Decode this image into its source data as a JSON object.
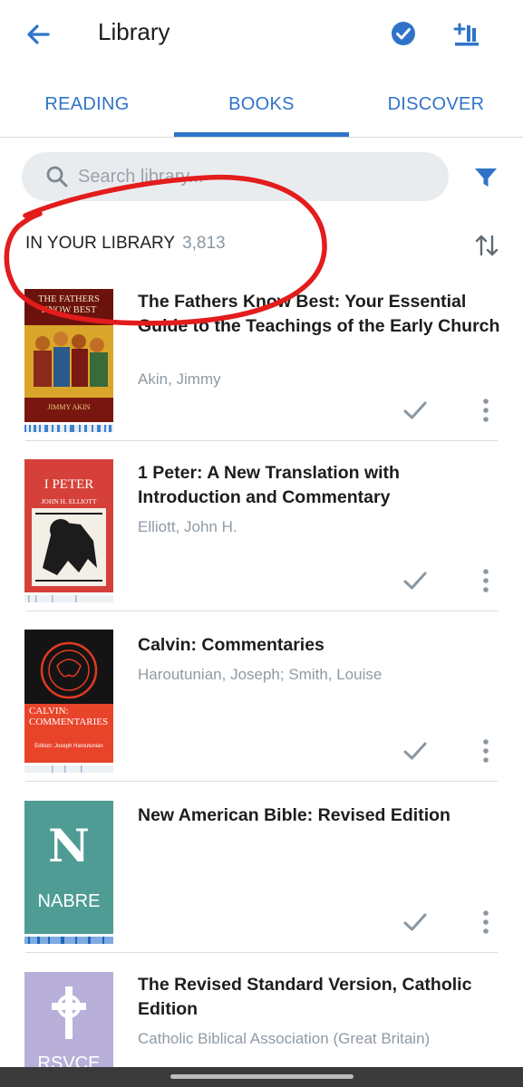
{
  "header": {
    "title": "Library",
    "back_icon": "arrow-left-icon",
    "check_icon": "check-circle-icon",
    "add_icon": "add-book-icon"
  },
  "tabs": [
    {
      "label": "READING",
      "active": false
    },
    {
      "label": "BOOKS",
      "active": true
    },
    {
      "label": "DISCOVER",
      "active": false
    }
  ],
  "search": {
    "placeholder": "Search library...",
    "value": ""
  },
  "library": {
    "label": "IN YOUR LIBRARY",
    "count": "3,813"
  },
  "books": [
    {
      "title": "The Fathers Know Best: Your Essential Guide to the Teachings of the Early Church",
      "author": "Akin, Jimmy",
      "cover": {
        "top_text": "THE FATHERS KNOW BEST",
        "bottom_text": "JIMMY AKIN",
        "bg": "#8e1c14"
      }
    },
    {
      "title": "1 Peter: A New Translation with Introduction and Commentary",
      "author": "Elliott, John H.",
      "cover": {
        "top_text": "I PETER",
        "bottom_text": "JOHN H. ELLIOTT",
        "bg": "#d6403a"
      }
    },
    {
      "title": "Calvin: Commentaries",
      "author": "Haroutunian, Joseph; Smith, Louise",
      "cover": {
        "top_text": "CALVIN: COMMENTARIES",
        "bottom_text": "Edition: Joseph Haroutunian",
        "bg": "#e8442a"
      }
    },
    {
      "title": "New American Bible: Revised Edition",
      "author": "",
      "cover": {
        "top_text": "N",
        "bottom_text": "NABRE",
        "bg": "#4f9c95"
      }
    },
    {
      "title": "The Revised Standard Version, Catholic Edition",
      "author": "Catholic Biblical Association (Great Britain)",
      "cover": {
        "top_text": "",
        "bottom_text": "RSVCE",
        "bg": "#b8b0d8"
      }
    }
  ],
  "colors": {
    "accent": "#2f73c9",
    "annotation": "#e31c1c"
  }
}
